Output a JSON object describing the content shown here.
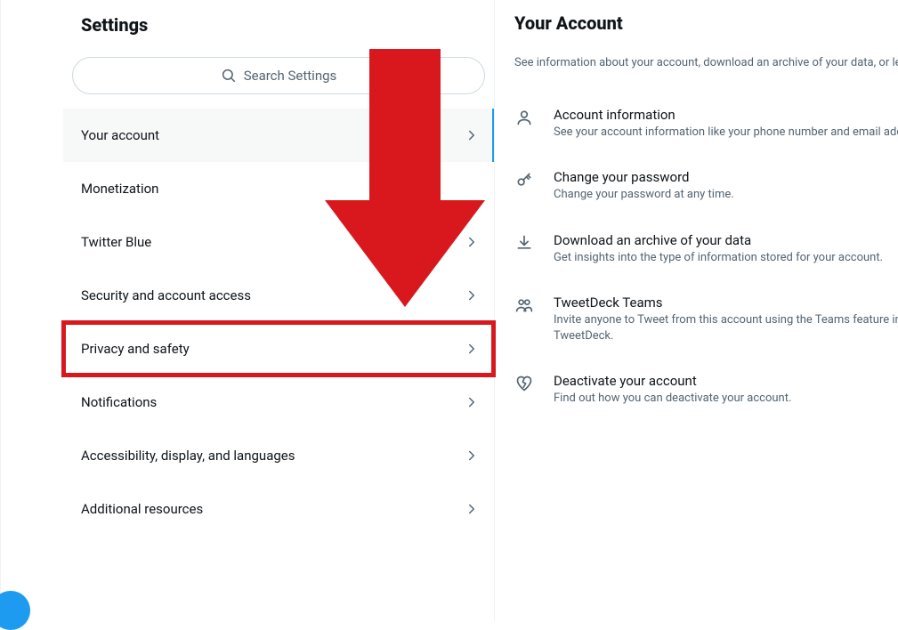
{
  "settings": {
    "title": "Settings",
    "search_placeholder": "Search Settings",
    "items": [
      {
        "label": "Your account",
        "has_chevron": true,
        "selected": true,
        "highlighted": false
      },
      {
        "label": "Monetization",
        "has_chevron": false,
        "selected": false,
        "highlighted": false
      },
      {
        "label": "Twitter Blue",
        "has_chevron": true,
        "selected": false,
        "highlighted": false
      },
      {
        "label": "Security and account access",
        "has_chevron": true,
        "selected": false,
        "highlighted": false
      },
      {
        "label": "Privacy and safety",
        "has_chevron": true,
        "selected": false,
        "highlighted": true
      },
      {
        "label": "Notifications",
        "has_chevron": true,
        "selected": false,
        "highlighted": false
      },
      {
        "label": "Accessibility, display, and languages",
        "has_chevron": true,
        "selected": false,
        "highlighted": false
      },
      {
        "label": "Additional resources",
        "has_chevron": true,
        "selected": false,
        "highlighted": false
      }
    ]
  },
  "account": {
    "title": "Your Account",
    "subtitle": "See information about your account, download an archive of your data, or learn about your\naccount deactivation options",
    "details": [
      {
        "icon": "person-icon",
        "title": "Account information",
        "desc": "See your account information like your phone number and email address."
      },
      {
        "icon": "key-icon",
        "title": "Change your password",
        "desc": "Change your password at any time."
      },
      {
        "icon": "download-icon",
        "title": "Download an archive of your data",
        "desc": "Get insights into the type of information stored for your account."
      },
      {
        "icon": "people-icon",
        "title": "TweetDeck Teams",
        "desc": "Invite anyone to Tweet from this account using the Teams feature in\nTweetDeck."
      },
      {
        "icon": "heart-broken-icon",
        "title": "Deactivate your account",
        "desc": "Find out how you can deactivate your account."
      }
    ]
  }
}
